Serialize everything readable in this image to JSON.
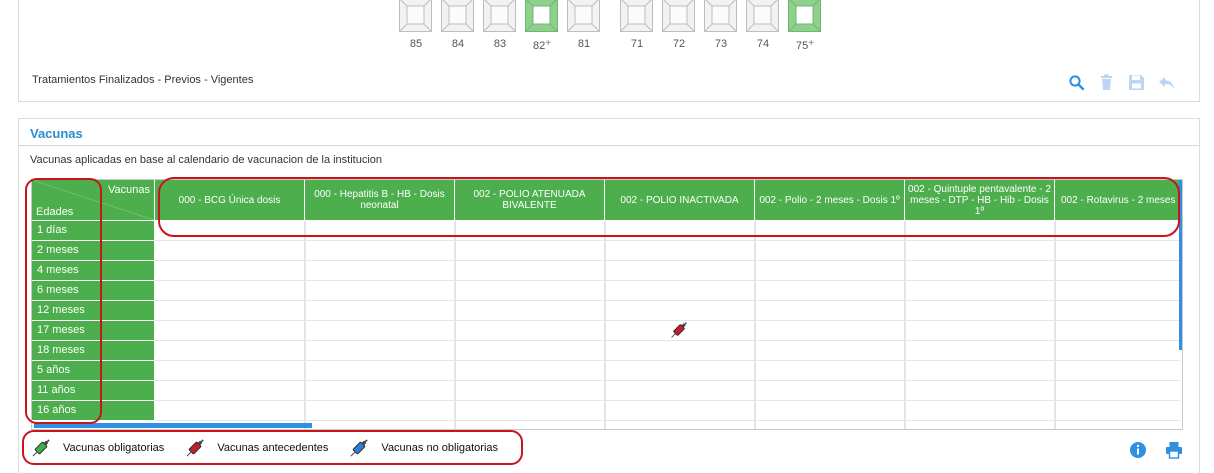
{
  "odontogram": {
    "teeth": [
      {
        "number": "85",
        "mark": "",
        "state": "normal"
      },
      {
        "number": "84",
        "mark": "",
        "state": "normal"
      },
      {
        "number": "83",
        "mark": "",
        "state": "normal"
      },
      {
        "number": "82",
        "mark": "+",
        "state": "green"
      },
      {
        "number": "81",
        "mark": "",
        "state": "normal"
      },
      {
        "number": "71",
        "mark": "",
        "state": "normal"
      },
      {
        "number": "72",
        "mark": "",
        "state": "normal"
      },
      {
        "number": "73",
        "mark": "",
        "state": "normal"
      },
      {
        "number": "74",
        "mark": "",
        "state": "normal"
      },
      {
        "number": "75",
        "mark": "+",
        "state": "green"
      }
    ],
    "treatments_label": "Tratamientos Finalizados - Previos - Vigentes",
    "toolbar_icons": [
      "search-icon",
      "trash-icon",
      "save-icon",
      "undo-icon"
    ]
  },
  "vaccines": {
    "title": "Vacunas",
    "description": "Vacunas aplicadas en base al calendario de vacunacion de la institucion",
    "corner_vaccines_label": "Vacunas",
    "corner_ages_label": "Edades",
    "columns": [
      "000 - BCG Única dosis",
      "000 - Hepatitis B - HB - Dosis neonatal",
      "002 - POLIO ATENUADA BIVALENTE",
      "002 - POLIO INACTIVADA",
      "002 - Polio - 2 meses - Dosis 1º",
      "002 - Quintuple pentavalente - 2 meses - DTP - HB - Hib - Dosis 1º",
      "002 - Rotavirus - 2 meses"
    ],
    "ages": [
      "1 días",
      "2 meses",
      "4 meses",
      "6 meses",
      "12 meses",
      "17 meses",
      "18 meses",
      "5 años",
      "11 años",
      "16 años"
    ],
    "legend": [
      {
        "label": "Vacunas obligatorias",
        "icon": "syringe-green-icon",
        "color": "#3fae49"
      },
      {
        "label": "Vacunas antecedentes",
        "icon": "syringe-red-icon",
        "color": "#c0202a"
      },
      {
        "label": "Vacunas no obligatorias",
        "icon": "syringe-blue-icon",
        "color": "#2f7fd0"
      }
    ],
    "footer_icons": [
      "info-icon",
      "print-icon"
    ]
  },
  "colors": {
    "header_green": "#4cae4c",
    "accent_blue": "#2b8ccf",
    "annotation_red": "#c9141b"
  }
}
